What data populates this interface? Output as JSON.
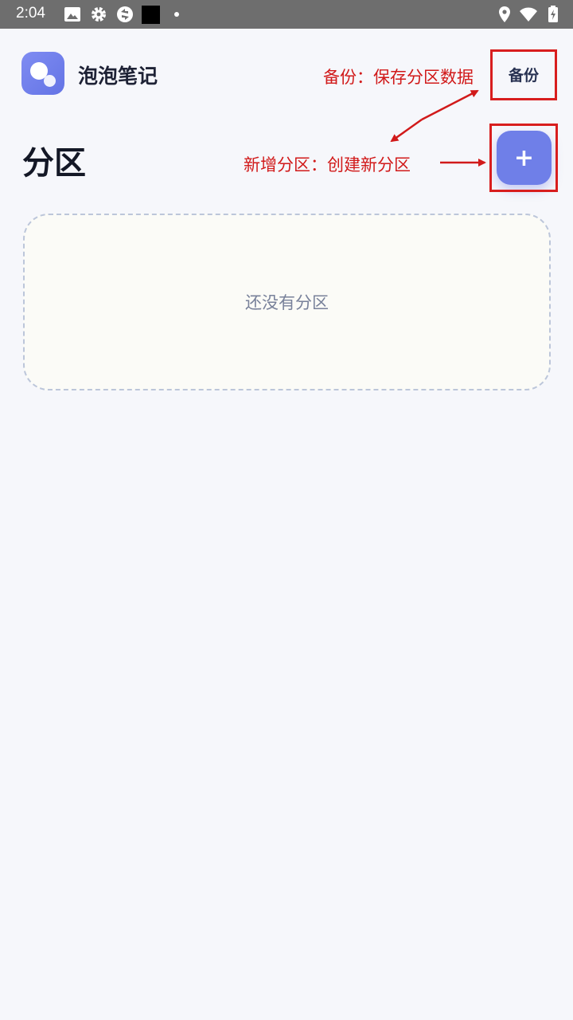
{
  "status_bar": {
    "time": "2:04",
    "icons": [
      "image-icon",
      "settings-gear-icon",
      "sync-icon",
      "black-square-icon",
      "dot-icon",
      "location-icon",
      "wifi-icon",
      "battery-charging-icon"
    ]
  },
  "app": {
    "name": "泡泡笔记",
    "logo_icon": "bubbles-logo-icon",
    "accent_color": "#6f7fe8"
  },
  "header": {
    "backup_label": "备份"
  },
  "page": {
    "title": "分区",
    "add_label": "+"
  },
  "empty_state": {
    "text": "还没有分区"
  },
  "annotations": {
    "backup_note": "备份：保存分区数据",
    "add_note": "新增分区：创建新分区",
    "color": "#d11a1a"
  }
}
